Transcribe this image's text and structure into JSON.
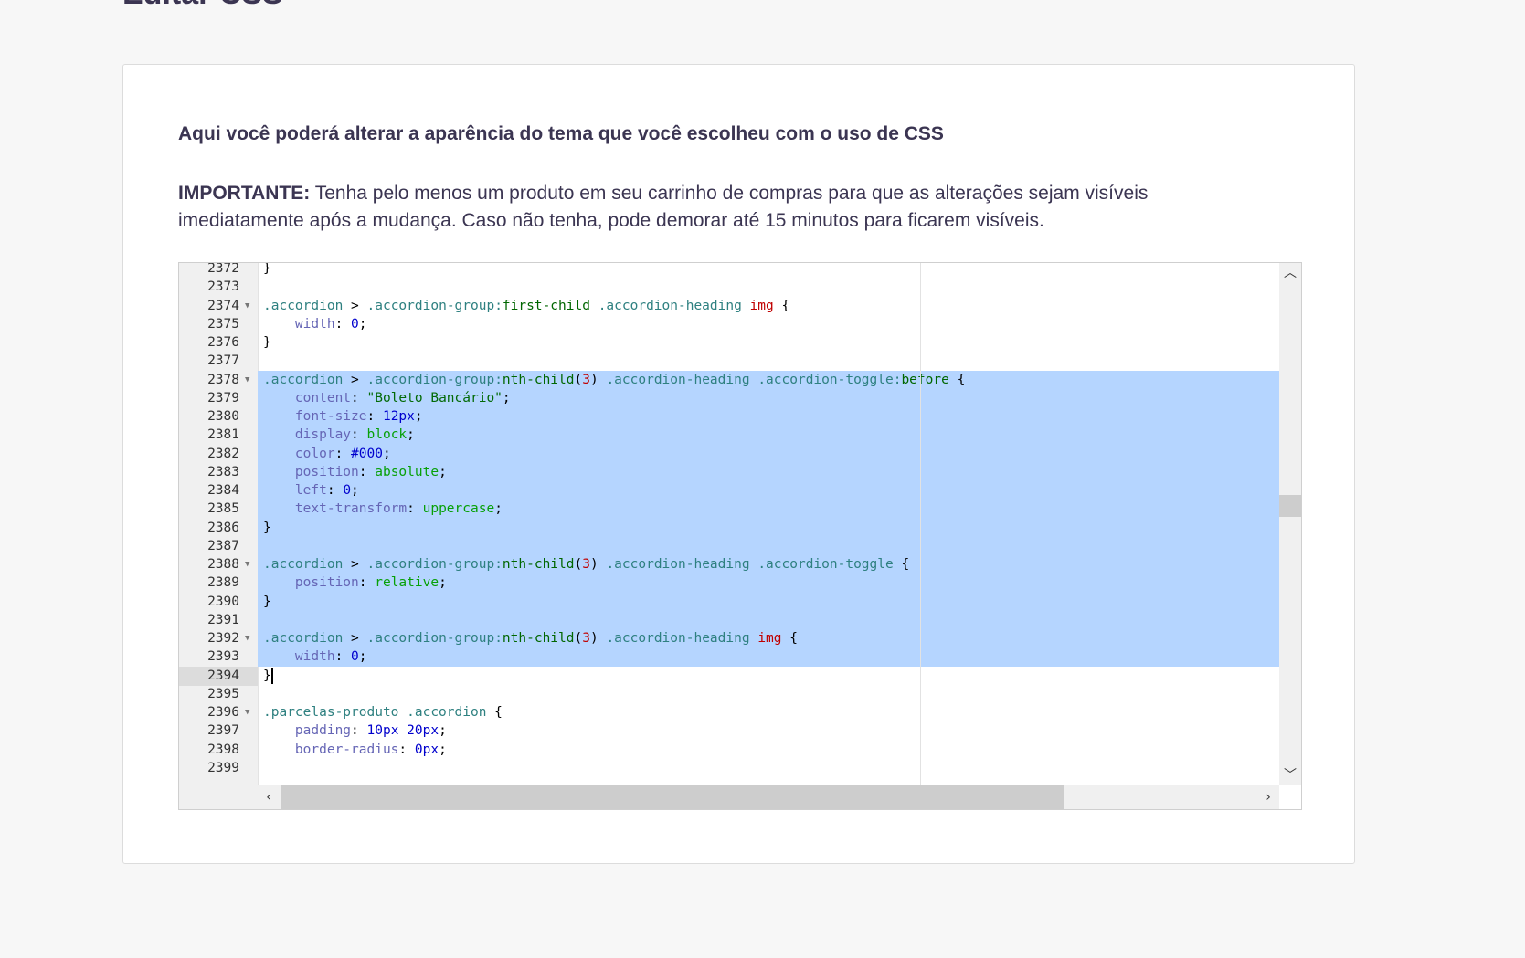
{
  "page": {
    "title": "Editar CSS",
    "intro": "Aqui você poderá alterar a aparência do tema que você escolheu com o uso de CSS",
    "notice_label": "IMPORTANTE:",
    "notice_text": " Tenha pelo menos um produto em seu carrinho de compras para que as alterações sejam visíveis imediatamente após a mudança. Caso não tenha, pode demorar até 15 minutos para ficarem visíveis."
  },
  "editor": {
    "active_line": 2394,
    "selection": {
      "from_line": 2378,
      "to_line": 2393
    },
    "lines": [
      {
        "n": 2372,
        "fold": false,
        "tokens": [
          [
            "punc",
            "}"
          ]
        ]
      },
      {
        "n": 2373,
        "fold": false,
        "tokens": []
      },
      {
        "n": 2374,
        "fold": true,
        "tokens": [
          [
            "cls",
            ".accordion"
          ],
          [
            "punc",
            " > "
          ],
          [
            "cls",
            ".accordion-group:"
          ],
          [
            "pseudo",
            "first-child"
          ],
          [
            "punc",
            " "
          ],
          [
            "cls",
            ".accordion-heading"
          ],
          [
            "punc",
            " "
          ],
          [
            "tag",
            "img"
          ],
          [
            "punc",
            " {"
          ]
        ]
      },
      {
        "n": 2375,
        "fold": false,
        "tokens": [
          [
            "punc",
            "    "
          ],
          [
            "prop",
            "width"
          ],
          [
            "punc",
            ": "
          ],
          [
            "num",
            "0"
          ],
          [
            "punc",
            ";"
          ]
        ]
      },
      {
        "n": 2376,
        "fold": false,
        "tokens": [
          [
            "punc",
            "}"
          ]
        ]
      },
      {
        "n": 2377,
        "fold": false,
        "tokens": []
      },
      {
        "n": 2378,
        "fold": true,
        "tokens": [
          [
            "cls",
            ".accordion"
          ],
          [
            "punc",
            " > "
          ],
          [
            "cls",
            ".accordion-group:"
          ],
          [
            "pseudo",
            "nth-child"
          ],
          [
            "punc",
            "("
          ],
          [
            "tag",
            "3"
          ],
          [
            "punc",
            ") "
          ],
          [
            "cls",
            ".accordion-heading"
          ],
          [
            "punc",
            " "
          ],
          [
            "cls",
            ".accordion-toggle:"
          ],
          [
            "pseudo",
            "before"
          ],
          [
            "punc",
            " {"
          ]
        ]
      },
      {
        "n": 2379,
        "fold": false,
        "tokens": [
          [
            "punc",
            "    "
          ],
          [
            "prop",
            "content"
          ],
          [
            "punc",
            ": "
          ],
          [
            "str",
            "\"Boleto Bancário\""
          ],
          [
            "punc",
            ";"
          ]
        ]
      },
      {
        "n": 2380,
        "fold": false,
        "tokens": [
          [
            "punc",
            "    "
          ],
          [
            "prop",
            "font-size"
          ],
          [
            "punc",
            ": "
          ],
          [
            "num",
            "12px"
          ],
          [
            "punc",
            ";"
          ]
        ]
      },
      {
        "n": 2381,
        "fold": false,
        "tokens": [
          [
            "punc",
            "    "
          ],
          [
            "prop",
            "display"
          ],
          [
            "punc",
            ": "
          ],
          [
            "kw",
            "block"
          ],
          [
            "punc",
            ";"
          ]
        ]
      },
      {
        "n": 2382,
        "fold": false,
        "tokens": [
          [
            "punc",
            "    "
          ],
          [
            "prop",
            "color"
          ],
          [
            "punc",
            ": "
          ],
          [
            "hex",
            "#000"
          ],
          [
            "punc",
            ";"
          ]
        ]
      },
      {
        "n": 2383,
        "fold": false,
        "tokens": [
          [
            "punc",
            "    "
          ],
          [
            "prop",
            "position"
          ],
          [
            "punc",
            ": "
          ],
          [
            "kw",
            "absolute"
          ],
          [
            "punc",
            ";"
          ]
        ]
      },
      {
        "n": 2384,
        "fold": false,
        "tokens": [
          [
            "punc",
            "    "
          ],
          [
            "prop",
            "left"
          ],
          [
            "punc",
            ": "
          ],
          [
            "num",
            "0"
          ],
          [
            "punc",
            ";"
          ]
        ]
      },
      {
        "n": 2385,
        "fold": false,
        "tokens": [
          [
            "punc",
            "    "
          ],
          [
            "prop",
            "text-transform"
          ],
          [
            "punc",
            ": "
          ],
          [
            "kw",
            "uppercase"
          ],
          [
            "punc",
            ";"
          ]
        ]
      },
      {
        "n": 2386,
        "fold": false,
        "tokens": [
          [
            "punc",
            "}"
          ]
        ]
      },
      {
        "n": 2387,
        "fold": false,
        "tokens": []
      },
      {
        "n": 2388,
        "fold": true,
        "tokens": [
          [
            "cls",
            ".accordion"
          ],
          [
            "punc",
            " > "
          ],
          [
            "cls",
            ".accordion-group:"
          ],
          [
            "pseudo",
            "nth-child"
          ],
          [
            "punc",
            "("
          ],
          [
            "tag",
            "3"
          ],
          [
            "punc",
            ") "
          ],
          [
            "cls",
            ".accordion-heading"
          ],
          [
            "punc",
            " "
          ],
          [
            "cls",
            ".accordion-toggle"
          ],
          [
            "punc",
            " {"
          ]
        ]
      },
      {
        "n": 2389,
        "fold": false,
        "tokens": [
          [
            "punc",
            "    "
          ],
          [
            "prop",
            "position"
          ],
          [
            "punc",
            ": "
          ],
          [
            "kw",
            "relative"
          ],
          [
            "punc",
            ";"
          ]
        ]
      },
      {
        "n": 2390,
        "fold": false,
        "tokens": [
          [
            "punc",
            "}"
          ]
        ]
      },
      {
        "n": 2391,
        "fold": false,
        "tokens": []
      },
      {
        "n": 2392,
        "fold": true,
        "tokens": [
          [
            "cls",
            ".accordion"
          ],
          [
            "punc",
            " > "
          ],
          [
            "cls",
            ".accordion-group:"
          ],
          [
            "pseudo",
            "nth-child"
          ],
          [
            "punc",
            "("
          ],
          [
            "tag",
            "3"
          ],
          [
            "punc",
            ") "
          ],
          [
            "cls",
            ".accordion-heading"
          ],
          [
            "punc",
            " "
          ],
          [
            "tag",
            "img"
          ],
          [
            "punc",
            " {"
          ]
        ]
      },
      {
        "n": 2393,
        "fold": false,
        "tokens": [
          [
            "punc",
            "    "
          ],
          [
            "prop",
            "width"
          ],
          [
            "punc",
            ": "
          ],
          [
            "num",
            "0"
          ],
          [
            "punc",
            ";"
          ]
        ]
      },
      {
        "n": 2394,
        "fold": false,
        "tokens": [
          [
            "punc",
            "}"
          ]
        ],
        "cursor": true
      },
      {
        "n": 2395,
        "fold": false,
        "tokens": []
      },
      {
        "n": 2396,
        "fold": true,
        "tokens": [
          [
            "cls",
            ".parcelas-produto"
          ],
          [
            "punc",
            " "
          ],
          [
            "cls",
            ".accordion"
          ],
          [
            "punc",
            " {"
          ]
        ]
      },
      {
        "n": 2397,
        "fold": false,
        "tokens": [
          [
            "punc",
            "    "
          ],
          [
            "prop",
            "padding"
          ],
          [
            "punc",
            ": "
          ],
          [
            "num",
            "10px 20px"
          ],
          [
            "punc",
            ";"
          ]
        ]
      },
      {
        "n": 2398,
        "fold": false,
        "tokens": [
          [
            "punc",
            "    "
          ],
          [
            "prop",
            "border-radius"
          ],
          [
            "punc",
            ": "
          ],
          [
            "num",
            "0px"
          ],
          [
            "punc",
            ";"
          ]
        ]
      },
      {
        "n": 2399,
        "fold": false,
        "tokens": []
      }
    ]
  }
}
